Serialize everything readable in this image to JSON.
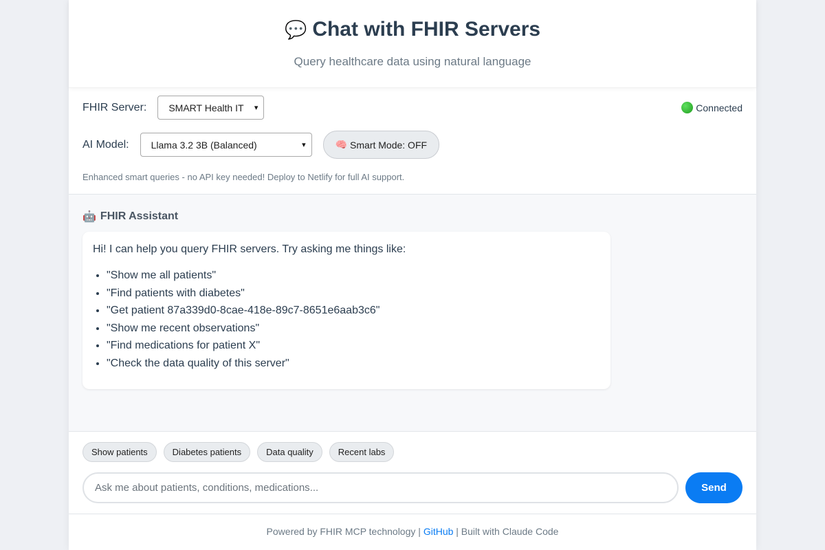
{
  "header": {
    "title_icon": "speech-bubble-icon",
    "title_emoji": "💬",
    "title": "Chat with FHIR Servers",
    "subtitle": "Query healthcare data using natural language"
  },
  "controls": {
    "server_label": "FHIR Server:",
    "server_selected": "SMART Health IT",
    "status_text": "Connected",
    "status_color": "#22a722",
    "model_label": "AI Model:",
    "model_selected": "Llama 3.2 3B (Balanced)",
    "smart_mode_emoji": "🧠",
    "smart_mode_label": "Smart Mode: OFF",
    "hint": "Enhanced smart queries - no API key needed! Deploy to Netlify for full AI support."
  },
  "chat": {
    "assistant_emoji": "🤖",
    "assistant_name": "FHIR Assistant",
    "intro": "Hi! I can help you query FHIR servers. Try asking me things like:",
    "examples": [
      "\"Show me all patients\"",
      "\"Find patients with diabetes\"",
      "\"Get patient 87a339d0-8cae-418e-89c7-8651e6aab3c6\"",
      "\"Show me recent observations\"",
      "\"Find medications for patient X\"",
      "\"Check the data quality of this server\""
    ]
  },
  "input": {
    "chips": [
      "Show patients",
      "Diabetes patients",
      "Data quality",
      "Recent labs"
    ],
    "placeholder": "Ask me about patients, conditions, medications...",
    "value": "",
    "send_label": "Send"
  },
  "footer": {
    "prefix": "Powered by FHIR MCP technology | ",
    "link_text": "GitHub",
    "suffix": " | Built with Claude Code"
  },
  "colors": {
    "accent": "#0a7cf3",
    "title": "#2c3e50",
    "muted": "#6c7a86",
    "page_bg": "#eef0f4"
  }
}
